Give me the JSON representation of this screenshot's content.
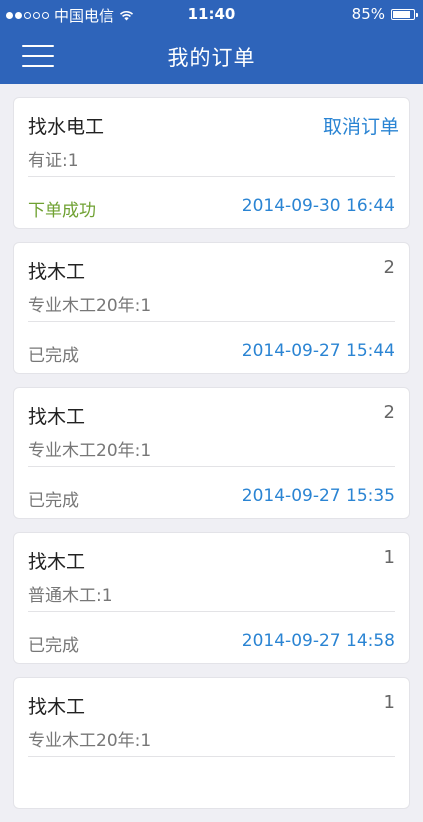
{
  "status_bar": {
    "carrier": "中国电信",
    "time": "11:40",
    "battery": "85%",
    "battery_level": 0.85,
    "signal_bars": 2
  },
  "nav": {
    "title": "我的订单",
    "menu_icon": "hamburger-menu-icon"
  },
  "orders": [
    {
      "title": "找水电工",
      "action": "取消订单",
      "count": "",
      "detail": "有证:1",
      "status": "下单成功",
      "date": "2014-09-30 16:44"
    },
    {
      "title": "找木工",
      "action": "",
      "count": "2",
      "detail": "专业木工20年:1",
      "status": "已完成",
      "date": "2014-09-27 15:44"
    },
    {
      "title": "找木工",
      "action": "",
      "count": "2",
      "detail": "专业木工20年:1",
      "status": "已完成",
      "date": "2014-09-27 15:35"
    },
    {
      "title": "找木工",
      "action": "",
      "count": "1",
      "detail": "普通木工:1",
      "status": "已完成",
      "date": "2014-09-27 14:58"
    },
    {
      "title": "找木工",
      "action": "",
      "count": "1",
      "detail": "专业木工20年:1",
      "status": "",
      "date": ""
    }
  ],
  "colors": {
    "header": "#2e64ba",
    "link": "#2a84d3",
    "success": "#6fa132",
    "background": "#efeff4"
  }
}
